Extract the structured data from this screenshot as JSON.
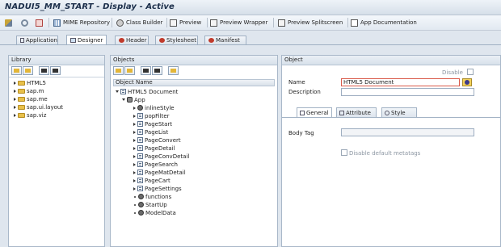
{
  "window": {
    "title": "NADUI5_MM_START - Display - Active"
  },
  "toolbar": {
    "mime": "MIME Repository",
    "class_builder": "Class Builder",
    "preview": "Preview",
    "preview_wrapper": "Preview Wrapper",
    "preview_splitscreen": "Preview Splitscreen",
    "app_documentation": "App Documentation"
  },
  "tabs": [
    "Application",
    "Designer",
    "Header",
    "Stylesheet",
    "Manifest"
  ],
  "library": {
    "title": "Library",
    "items": [
      "HTML5",
      "sap.m",
      "sap.me",
      "sap.ui.layout",
      "sap.viz"
    ]
  },
  "objects": {
    "title": "Objects",
    "column_header": "Object Name",
    "root": "HTML5 Document",
    "app": "App",
    "children": [
      "inlineStyle",
      "popFilter",
      "PageStart",
      "PageList",
      "PageConvert",
      "PageDetail",
      "PageConvDetail",
      "PageSearch",
      "PageMatDetail",
      "PageCart",
      "PageSettings",
      "functions",
      "StartUp",
      "ModelData"
    ]
  },
  "object_panel": {
    "title": "Object",
    "disable_label": "Disable",
    "name_label": "Name",
    "name_value": "HTML5 Document",
    "description_label": "Description",
    "description_value": "",
    "subtabs": [
      "General",
      "Attribute",
      "Style"
    ],
    "body_tag_label": "Body Tag",
    "body_tag_value": "",
    "disable_metatags_label": "Disable default metatags"
  },
  "colors": {
    "accent": "#1b2e4a",
    "panel_header": "#d8e1eb",
    "background": "#dfe6ee"
  }
}
